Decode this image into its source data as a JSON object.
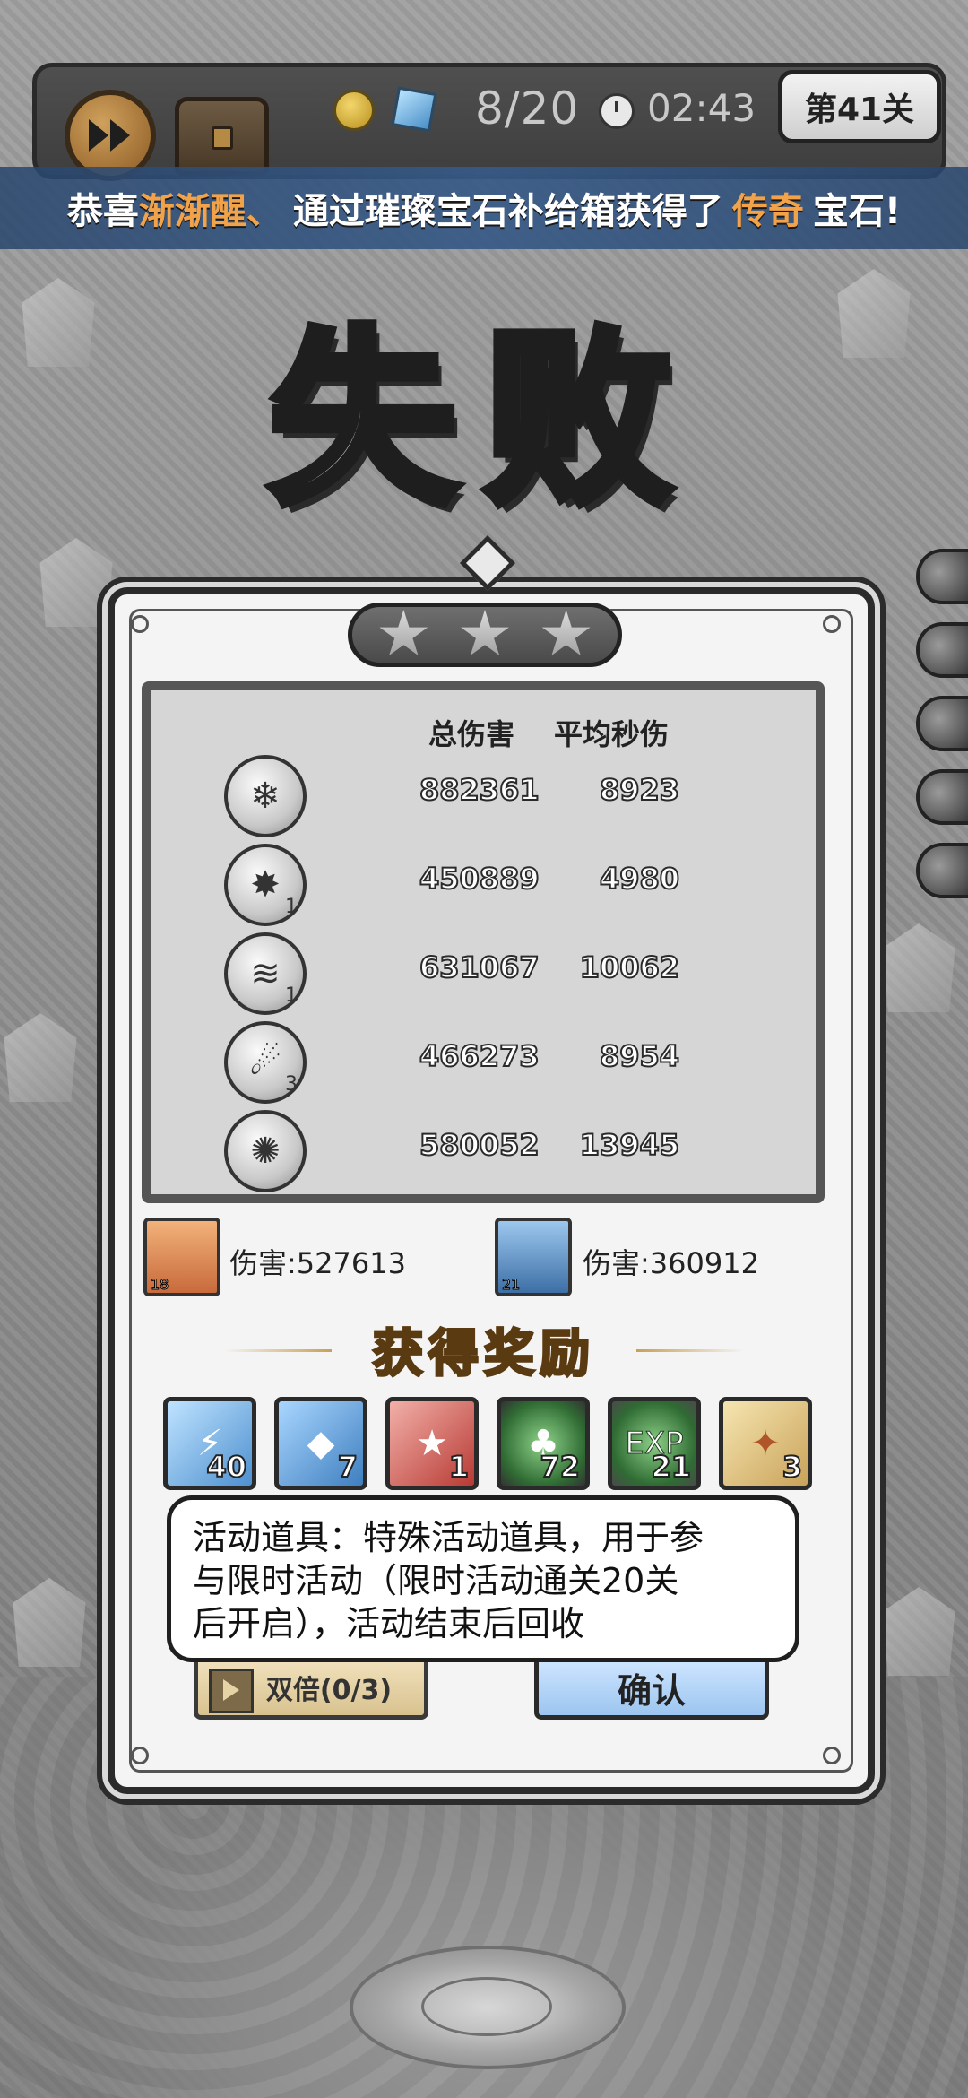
{
  "hud": {
    "wave": "8/20",
    "timer": "02:43",
    "stage": "第41关"
  },
  "marquee": {
    "prefix": "恭喜",
    "player": "渐渐醒、",
    "middle": "通过璀璨宝石补给箱获得了",
    "rarity": "传奇",
    "suffix": "宝石!"
  },
  "result_title": "失败",
  "stars": {
    "earned": 0,
    "total": 3
  },
  "stats": {
    "header_total": "总伤害",
    "header_avg": "平均秒伤",
    "rows": [
      {
        "icon": "ice-splash-skill-icon",
        "level": "",
        "total": "882361",
        "avg": "8923"
      },
      {
        "icon": "crystal-shard-skill-icon",
        "level": "1",
        "total": "450889",
        "avg": "4980"
      },
      {
        "icon": "tornado-skill-icon",
        "level": "1",
        "total": "631067",
        "avg": "10062"
      },
      {
        "icon": "meteor-skill-icon",
        "level": "3",
        "total": "466273",
        "avg": "8954"
      },
      {
        "icon": "black-hole-skill-icon",
        "level": "",
        "total": "580052",
        "avg": "13945"
      }
    ]
  },
  "heroes": [
    {
      "level": "18",
      "damage": "伤害:527613"
    },
    {
      "level": "21",
      "damage": "伤害:360912"
    }
  ],
  "rewards": {
    "title": "获得奖励",
    "items": [
      {
        "icon": "ice-crystal-icon",
        "count": "40"
      },
      {
        "icon": "dark-crystal-icon",
        "count": "7"
      },
      {
        "icon": "red-card-icon",
        "count": "1"
      },
      {
        "icon": "green-emblem-icon",
        "count": "72"
      },
      {
        "icon": "exp-orb-icon",
        "label": "EXP",
        "count": "21"
      },
      {
        "icon": "scroll-icon",
        "count": "3"
      }
    ]
  },
  "tooltip": {
    "line1": "活动道具：特殊活动道具，用于参",
    "line2": "与限时活动（限时活动通关20关",
    "line3": "后开启），活动结束后回收"
  },
  "buttons": {
    "double": "双倍(0/3)",
    "confirm": "确认"
  }
}
